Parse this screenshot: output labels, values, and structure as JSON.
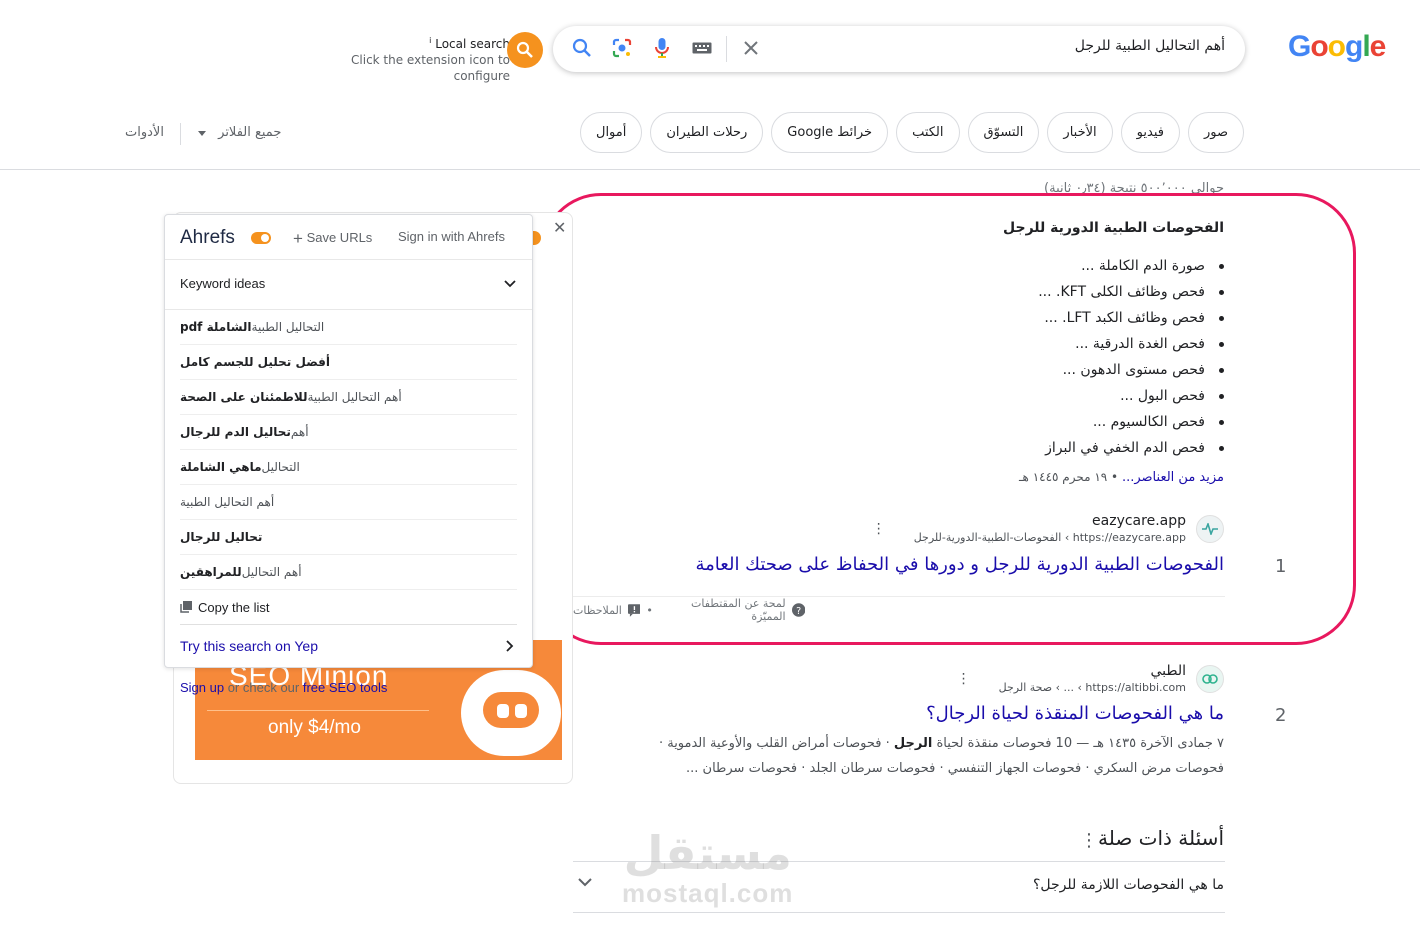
{
  "logo": {
    "letters": [
      "G",
      "o",
      "o",
      "g",
      "l",
      "e"
    ]
  },
  "search": {
    "query": "أهم التحاليل الطبية للرجل"
  },
  "extension": {
    "title": "Local search",
    "subtitle": "Click the extension icon to configure",
    "info": "i"
  },
  "chips": [
    "صور",
    "فيديو",
    "الأخبار",
    "التسوّق",
    "الكتب",
    "خرائط Google",
    "رحلات الطيران",
    "أموال"
  ],
  "filters": {
    "all_filters": "جميع الفلاتر",
    "tools": "الأدوات"
  },
  "stats": "حوالي ٥٠٠٬٠٠٠ نتيجة (٠٫٣٤ ثانية)",
  "featured": {
    "title": "الفحوصات الطبية الدورية للرجل",
    "items": [
      "صورة الدم الكاملة ...",
      "فحص وظائف الكلى KFT. ...",
      "فحص وظائف الكبد LFT. ...",
      "فحص الغدة الدرقية ...",
      "فحص مستوى الدهون ...",
      "فحص البول ...",
      "فحص الكالسيوم ...",
      "فحص الدم الخفي في البراز"
    ],
    "more_link": "مزيد من العناصر...",
    "date": "١٩ محرم ١٤٤٥ هـ",
    "about": "لمحة عن المقتطفات المميّزة",
    "feedback": "الملاحظات"
  },
  "results": [
    {
      "num": "1",
      "site": "eazycare.app",
      "url": "https://eazycare.app › الفحوصات-الطبية-الدورية-للرجل",
      "title": "الفحوصات الطبية الدورية للرجل و دورها في الحفاظ على صحتك العامة"
    },
    {
      "num": "2",
      "site": "الطبي",
      "url": "https://altibbi.com › ... › صحة الرجل",
      "title": "ما هي الفحوصات المنقذة لحياة الرجال؟",
      "snippet_date": "٧ جمادى الآخرة ١٤٣٥ هـ",
      "snippet_pre": "10 فحوصات منقذة لحياة ",
      "snippet_bold": "الرجل",
      "snippet_rest": " · فحوصات أمراض القلب والأوعية الدموية · فحوصات مرض السكري · فحوصات الجهاز التنفسي · فحوصات سرطان الجلد · فحوصات سرطان ..."
    }
  ],
  "related": {
    "title": "أسئلة ذات صلة",
    "questions": [
      "ما هي الفحوصات اللازمة للرجل؟"
    ]
  },
  "ahrefs": {
    "logo": "Ahrefs",
    "save_urls": "Save URLs",
    "sign_in": "Sign in with Ahrefs",
    "keyword_ideas": "Keyword ideas",
    "keywords": [
      {
        "plain": "التحاليل الطبية ",
        "bold": "الشاملة pdf"
      },
      {
        "plain": "",
        "bold": "أفضل تحليل للجسم كامل"
      },
      {
        "plain": "أهم التحاليل الطبية ",
        "bold": "للاطمئنان على الصحة"
      },
      {
        "plain": "أهم ",
        "bold": "تحاليل الدم للرجال"
      },
      {
        "plain": "التحاليل ",
        "bold": "ماهي الشاملة"
      },
      {
        "plain": "أهم التحاليل الطبية",
        "bold": ""
      },
      {
        "plain": "",
        "bold": "تحاليل للرجال"
      },
      {
        "plain": "أهم التحاليل ",
        "bold": "للمراهقين"
      }
    ],
    "copy_list": "Copy the list",
    "yep": "Try this search on Yep"
  },
  "promo": {
    "title": "SEO Minion",
    "price": "only $4/mo",
    "signup_pre": "Sign up",
    "signup_mid": " or check our ",
    "signup_link": "free SEO tools"
  },
  "watermark": {
    "ar": "مستقل",
    "en": "mostaql.com"
  }
}
